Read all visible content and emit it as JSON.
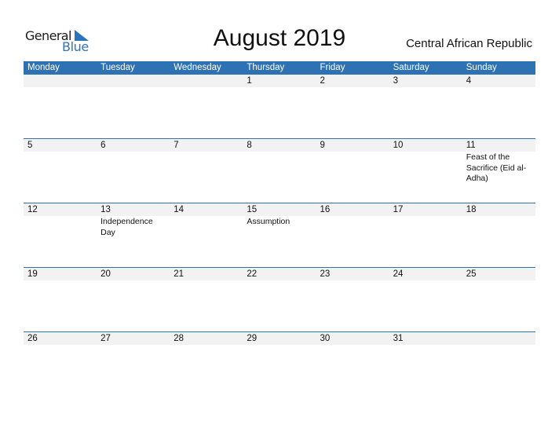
{
  "logo": {
    "general": "General",
    "blue": "Blue",
    "brand_color": "#2b73bc"
  },
  "title": "August 2019",
  "country": "Central African Republic",
  "header_color": "#2e72b4",
  "weekdays": [
    "Monday",
    "Tuesday",
    "Wednesday",
    "Thursday",
    "Friday",
    "Saturday",
    "Sunday"
  ],
  "weeks": [
    {
      "days": [
        "",
        "",
        "",
        "1",
        "2",
        "3",
        "4"
      ],
      "events": [
        "",
        "",
        "",
        "",
        "",
        "",
        ""
      ]
    },
    {
      "days": [
        "5",
        "6",
        "7",
        "8",
        "9",
        "10",
        "11"
      ],
      "events": [
        "",
        "",
        "",
        "",
        "",
        "",
        "Feast of the Sacrifice (Eid al-Adha)"
      ]
    },
    {
      "days": [
        "12",
        "13",
        "14",
        "15",
        "16",
        "17",
        "18"
      ],
      "events": [
        "",
        "Independence Day",
        "",
        "Assumption",
        "",
        "",
        ""
      ]
    },
    {
      "days": [
        "19",
        "20",
        "21",
        "22",
        "23",
        "24",
        "25"
      ],
      "events": [
        "",
        "",
        "",
        "",
        "",
        "",
        ""
      ]
    },
    {
      "days": [
        "26",
        "27",
        "28",
        "29",
        "30",
        "31",
        ""
      ],
      "events": [
        "",
        "",
        "",
        "",
        "",
        "",
        ""
      ]
    }
  ]
}
